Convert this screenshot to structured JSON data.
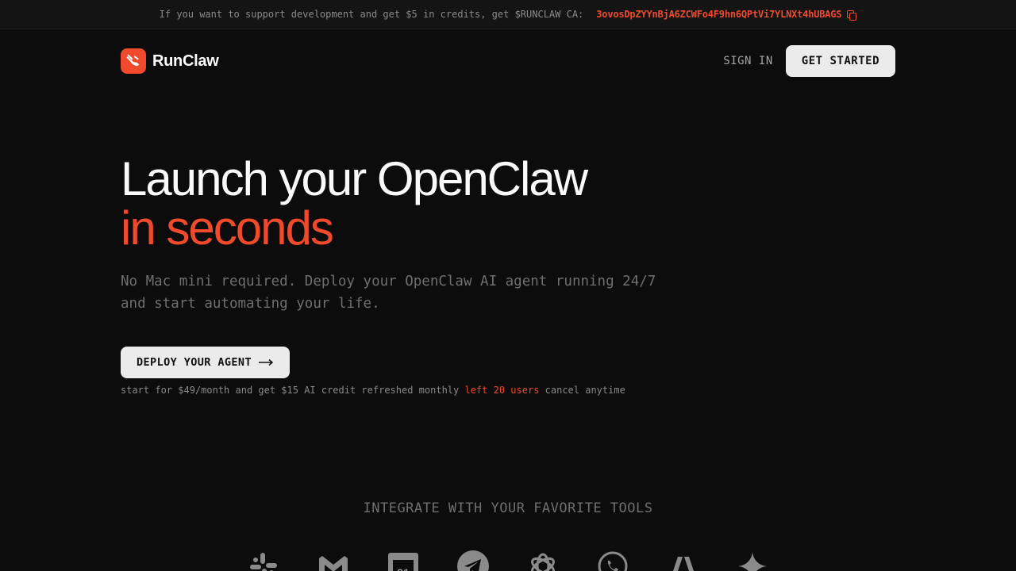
{
  "banner": {
    "text": "If you want to support development and get $5 in credits, get $RUNCLAW CA:",
    "contract": "3ovosDpZYYnBjA6ZCWFo4F9hn6QPtVi7YLNXt4hUBAGS",
    "copy_icon": "copy-icon"
  },
  "nav": {
    "brand": "RunClaw",
    "logo_icon": "claw-logo-icon",
    "sign_in": "SIGN IN",
    "get_started": "GET STARTED"
  },
  "hero": {
    "title_line1": "Launch your OpenClaw",
    "title_line2": "in seconds",
    "subtitle": "No Mac mini required. Deploy your OpenClaw AI agent running 24/7 and start automating your life.",
    "cta": "DEPLOY YOUR AGENT",
    "cta_icon": "arrow-right-icon",
    "pricing_pre": "start for $49/month and get $15 AI credit refreshed monthly",
    "pricing_highlight": "left 20 users",
    "pricing_post": "cancel anytime"
  },
  "integrations": {
    "heading": "INTEGRATE WITH YOUR FAVORITE TOOLS",
    "tools": [
      "slack-icon",
      "gmail-icon",
      "google-calendar-icon",
      "telegram-icon",
      "openai-icon",
      "whatsapp-icon",
      "anthropic-icon",
      "gemini-icon"
    ],
    "calendar_day": "31"
  },
  "colors": {
    "accent": "#ef4a2b",
    "background": "#0c0c0c",
    "button": "#ebebeb"
  }
}
